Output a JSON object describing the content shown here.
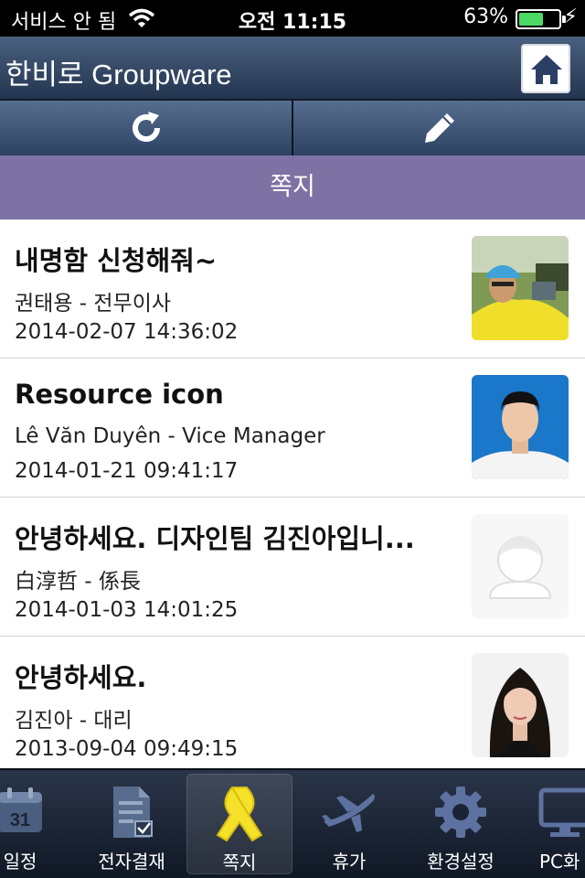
{
  "status_bar": {
    "carrier": "서비스 안 됨",
    "time": "오전 11:15",
    "battery_percent": "63%",
    "battery_level": 0.63
  },
  "header": {
    "title": "한비로 Groupware",
    "home_icon": "home-icon"
  },
  "toolbar": {
    "refresh_icon": "refresh-icon",
    "compose_icon": "pencil-icon"
  },
  "section": {
    "title": "쪽지"
  },
  "messages": [
    {
      "subject": "내명함 신청해줘~",
      "sender": "권태용 - 전무이사",
      "date": "2014-02-07 14:36:02",
      "avatar": "photo-golfer"
    },
    {
      "subject": "Resource icon",
      "sender": "Lê Văn Duyên - Vice Manager",
      "date": "2014-01-21 09:41:17",
      "avatar": "photo-man-blue-bg"
    },
    {
      "subject": "안녕하세요. 디자인팀 김진아입니...",
      "sender": "白淳哲 - 係長",
      "date": "2014-01-03 14:01:25",
      "avatar": "placeholder-avatar"
    },
    {
      "subject": "안녕하세요.",
      "sender": "김진아 - 대리",
      "date": "2013-09-04 09:49:15",
      "avatar": "photo-woman"
    }
  ],
  "tabs": [
    {
      "label": "일정",
      "icon": "calendar-icon",
      "day": "31"
    },
    {
      "label": "전자결재",
      "icon": "document-check-icon"
    },
    {
      "label": "쪽지",
      "icon": "ribbon-icon",
      "active": true
    },
    {
      "label": "휴가",
      "icon": "airplane-icon"
    },
    {
      "label": "환경설정",
      "icon": "gear-icon"
    },
    {
      "label": "PC화",
      "icon": "monitor-icon"
    }
  ]
}
